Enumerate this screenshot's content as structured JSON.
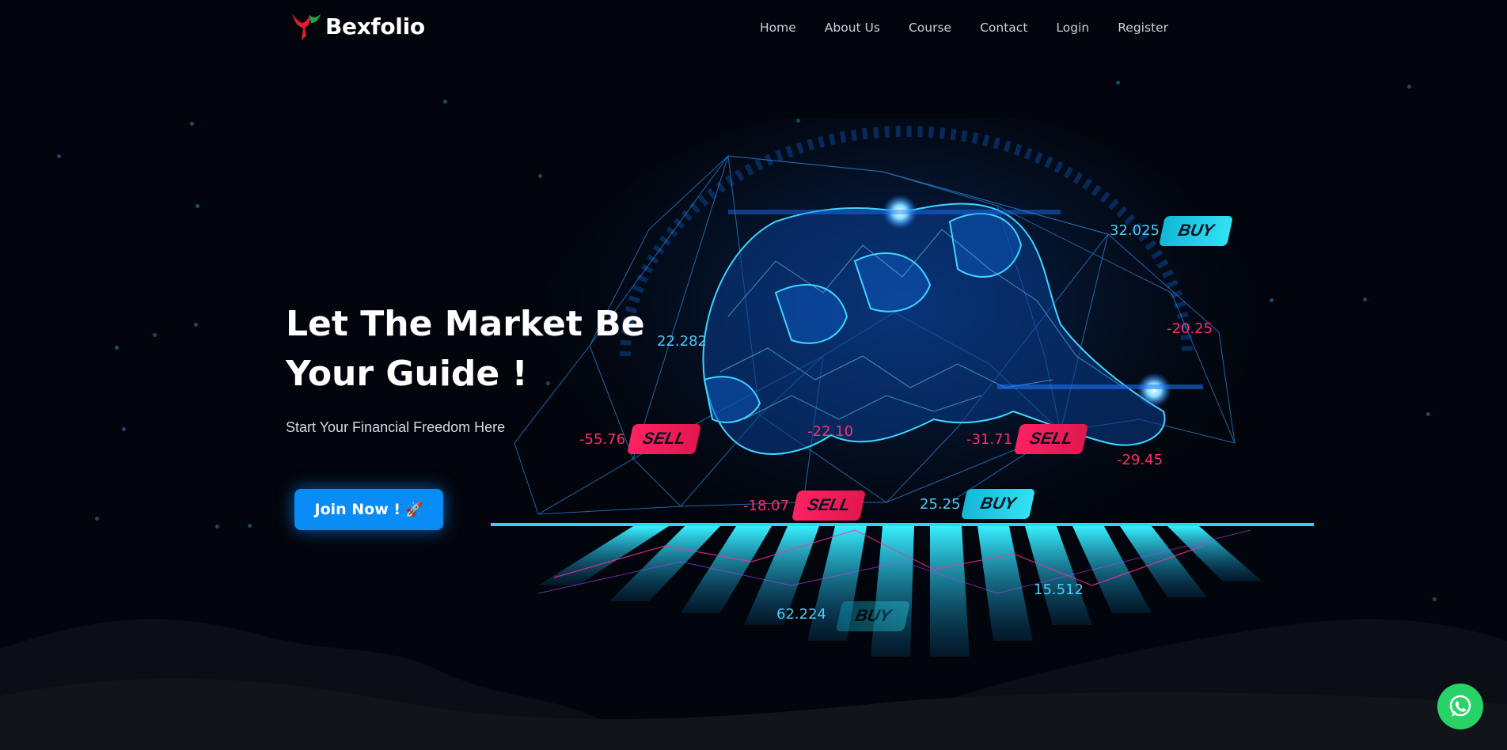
{
  "header": {
    "brand": "Bexfolio",
    "nav": [
      "Home",
      "About Us",
      "Course",
      "Contact",
      "Login",
      "Register"
    ]
  },
  "hero": {
    "title_line1": "Let The Market Be",
    "title_line2": "Your Guide !",
    "subtitle": "Start Your Financial Freedom Here",
    "cta_label": "Join Now !",
    "cta_icon": "rocket-icon"
  },
  "illustration": {
    "tags": [
      {
        "text": "32.025",
        "kind": "blue"
      },
      {
        "text": "-20.25",
        "kind": "red"
      },
      {
        "text": "22.282",
        "kind": "blue"
      },
      {
        "text": "-55.76",
        "kind": "red"
      },
      {
        "text": "-22.10",
        "kind": "red"
      },
      {
        "text": "-31.71",
        "kind": "red"
      },
      {
        "text": "-29.45",
        "kind": "red"
      },
      {
        "text": "-18.07",
        "kind": "red"
      },
      {
        "text": "25.25",
        "kind": "blue"
      },
      {
        "text": "15.512",
        "kind": "blue"
      },
      {
        "text": "62.224",
        "kind": "blue"
      }
    ],
    "badges": [
      {
        "text": "BUY",
        "kind": "buy"
      },
      {
        "text": "SELL",
        "kind": "sell"
      },
      {
        "text": "SELL",
        "kind": "sell"
      },
      {
        "text": "SELL",
        "kind": "sell"
      },
      {
        "text": "BUY",
        "kind": "buy"
      },
      {
        "text": "BUY",
        "kind": "buy"
      }
    ]
  },
  "whatsapp": {
    "icon": "whatsapp-icon"
  },
  "colors": {
    "background": "#02050b",
    "accent": "#0a8cf6",
    "buy": "#32e2f5",
    "sell": "#ff2163",
    "whatsapp": "#27d366"
  }
}
